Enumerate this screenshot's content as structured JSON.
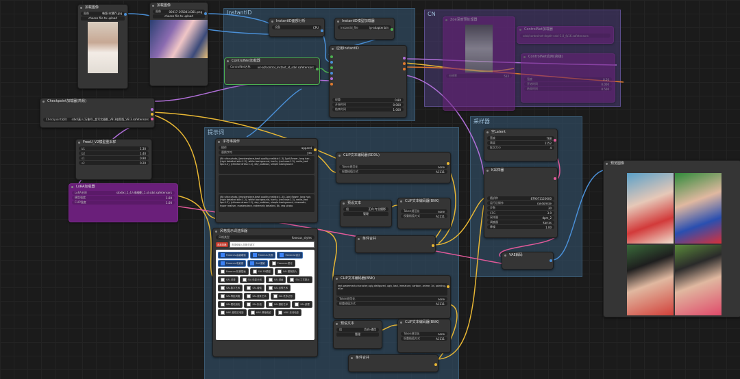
{
  "groups": {
    "instantid": "InstantID",
    "cn": "CN",
    "sampler": "采样器",
    "prompt": "提示词"
  },
  "load_image_1": {
    "title": "加载图像",
    "image_label": "图像",
    "image_value": "韩颖-宋慧乔.jpg",
    "upload": "choose file to upload"
  },
  "load_image_2": {
    "title": "加载图像",
    "image_label": "图像",
    "image_value": "00017-3958414381.png",
    "upload": "choose file to upload"
  },
  "instantid_face": {
    "title": "InstantID面部分析",
    "widget_label": "设备",
    "widget_value": "CPU"
  },
  "instantid_loader": {
    "title": "InstantID模型加载器",
    "widget_label": "instantid_file",
    "widget_value": "ip-adapter.bin"
  },
  "apply_instantid": {
    "title": "应用InstantID",
    "w1_label": "权重",
    "w1_value": "0.80",
    "w2_label": "开始时间",
    "w2_value": "0.000",
    "w3_label": "结束时间",
    "w3_value": "1.000"
  },
  "controlnet_loader": {
    "title": "ControlNet加载器",
    "widget_label": "ControlNet名称",
    "widget_value": "v4-sd/control_instant_id_sdxl.safetensors"
  },
  "checkpoint": {
    "title": "Checkpoint加载器(简易)",
    "widget_label": "Checkpoint名称",
    "widget_value": "sdxl/真人/万象XL_超写实摄影_V8.3推荐版_V8.3.safetensors"
  },
  "freeu": {
    "title": "FreeU_V2模型重采样",
    "b1": "1.30",
    "b2": "1.40",
    "s1": "0.90",
    "s2": "0.20",
    "b1_label": "b1",
    "b2_label": "b2",
    "s1_label": "s1",
    "s2_label": "s2"
  },
  "lora": {
    "title": "LoRA加载器",
    "w1_label": "LoRA名称",
    "w1_value": "sdxl/xl_1_4人像摄影_1.xl.sdxl.safetensors",
    "w2_label": "模型强度",
    "w2_value": "1.00",
    "w3_label": "CLIP强度",
    "w3_value": "1.00"
  },
  "text_op": {
    "title": "字符串操作",
    "w1_label": "操作",
    "w1_value": "append",
    "w2_label": "替换字符",
    "w2_value": "yes",
    "text1": "(8k ultra photo,((masterpiece,best quality,realistic:1.3),1girl,flower, long hair,(high detailed skin:1.2), white background, hanfu, (red rose:1.3), smile,(red lips:1.2), (chinese dress:1.1), day, outdoor, simple background",
    "text2": "",
    "text3": "(8k ultra photo,((masterpiece,best quality,realistic:1.3)),1girl,flower, long hair,(high detailed skin:1.2), white background, hanfu, (red rose:1.3), smile,(red lips:1.2), (chinese dress:1.1), day, outdoor, simple background, cinematic, hyper realism, masterpiece, extremely detailed, 8k, raw photo"
  },
  "style_selector": {
    "title": "风格提示词选择器",
    "w1_label": "风格类型",
    "w1_value": "fooocus_styles",
    "search_tag": "选择风格",
    "search_placeholder": "请搜索输入风格关键字",
    "styles": [
      {
        "label": "Fooocus-高级增强",
        "on": true
      },
      {
        "label": "Fooocus-负面",
        "on": true
      },
      {
        "label": "Fooocus-强大",
        "on": true
      },
      {
        "label": "Fooocus-电影感",
        "on": true
      },
      {
        "label": "SAI-摄影",
        "on": true
      },
      {
        "label": "Fooocus-锐化",
        "on": false
      },
      {
        "label": "Fooocus-机械插画",
        "on": false
      },
      {
        "label": "SAI-3D模型",
        "on": false
      },
      {
        "label": "SAI-模拟胶片",
        "on": false
      },
      {
        "label": "SAI-动漫",
        "on": false
      },
      {
        "label": "SAI-电影计划",
        "on": false
      },
      {
        "label": "SAI-漫画",
        "on": false
      },
      {
        "label": "SAI-工艺黏土",
        "on": false
      },
      {
        "label": "SAI-数字艺术",
        "on": false
      },
      {
        "label": "SAI-增强",
        "on": false
      },
      {
        "label": "SAI-幻想艺术",
        "on": false
      },
      {
        "label": "SAI-等距风格",
        "on": false
      },
      {
        "label": "SAI-线条艺术",
        "on": false
      },
      {
        "label": "SAI-低多边形",
        "on": false
      },
      {
        "label": "SAI-霓虹朋克",
        "on": false
      },
      {
        "label": "SAI-折纸",
        "on": false
      },
      {
        "label": "SAI-摄影艺术",
        "on": false
      },
      {
        "label": "SAI-纹理",
        "on": false
      },
      {
        "label": "MRE-超现实电影",
        "on": false
      },
      {
        "label": "MRE-黑暗电影",
        "on": false
      },
      {
        "label": "MRE-史诗电影",
        "on": false
      }
    ]
  },
  "clip_pos": {
    "title": "CLIP文本编码器(SDXL)",
    "w1_label": "Token规范化",
    "w1_value": "none",
    "w2_label": "权重插值方式",
    "w2_value": "A1111"
  },
  "preset_text_1": {
    "title": "预设文本",
    "w1_label": "组",
    "w1_value": "正向-专业摄影",
    "btn": "管理"
  },
  "clip_pos_2": {
    "title": "CLIP文本编码器(BNK)",
    "w1_label": "Token规范化",
    "w1_value": "none",
    "w2_label": "权重插值方式",
    "w2_value": "A1111"
  },
  "cond_combine_1": {
    "title": "条件合并"
  },
  "clip_neg": {
    "title": "CLIP文本编码器(BNK)",
    "text": "text,watermark,character,ugly,disfigured, ugly, bad, immature, cartoon, anime, 3d, painting, b&w",
    "w1_label": "Token规范化",
    "w1_value": "none",
    "w2_label": "权重插值方式",
    "w2_value": "A1111"
  },
  "preset_text_2": {
    "title": "预设文本",
    "w1_label": "组",
    "w1_value": "负向-通用",
    "btn": "管理"
  },
  "clip_neg_2": {
    "title": "CLIP文本编码器(BNK)",
    "w1_label": "Token规范化",
    "w1_value": "none",
    "w2_label": "权重插值方式",
    "w2_value": "A1111"
  },
  "cond_combine_2": {
    "title": "条件合并"
  },
  "cn_node_1": {
    "title": "ControlNet加载器",
    "widget_value": "sdxl/controlnet-depth-sdxl-1.0_fp16.safetensors"
  },
  "cn_node_2": {
    "title": "ControlNet应用(高级)",
    "w1_label": "强度",
    "w1_value": "0.50",
    "w2_label": "开始时间",
    "w2_value": "0.000",
    "w3_label": "结束时间",
    "w3_value": "0.500"
  },
  "cn_node_3": {
    "title": "Zoe深度预处理器",
    "w1_label": "分辨率",
    "w1_value": "512"
  },
  "empty_latent": {
    "title": "空Latent",
    "w1_label": "宽度",
    "w1_value": "768",
    "w2_label": "高度",
    "w2_value": "1152",
    "w3_label": "批次大小",
    "w3_value": "4"
  },
  "ksampler": {
    "title": "K采样器",
    "rows": [
      {
        "label": "随机种",
        "value": "879071120000"
      },
      {
        "label": "运行后操作",
        "value": "randomize"
      },
      {
        "label": "步数",
        "value": "30"
      },
      {
        "label": "CFG",
        "value": "3.0"
      },
      {
        "label": "采样器",
        "value": "dpm_2"
      },
      {
        "label": "调度器",
        "value": "karras"
      },
      {
        "label": "降噪",
        "value": "1.00"
      }
    ]
  },
  "vae_decode": {
    "title": "VAE解码"
  },
  "preview": {
    "title": "预览图像"
  },
  "colors": {
    "accent": "#4caf50",
    "wire_yellow": "#e8b734",
    "wire_blue": "#4a8fd6",
    "wire_purple": "#b06fd8",
    "wire_pink": "#e25a9a",
    "wire_orange": "#e07a2e"
  }
}
